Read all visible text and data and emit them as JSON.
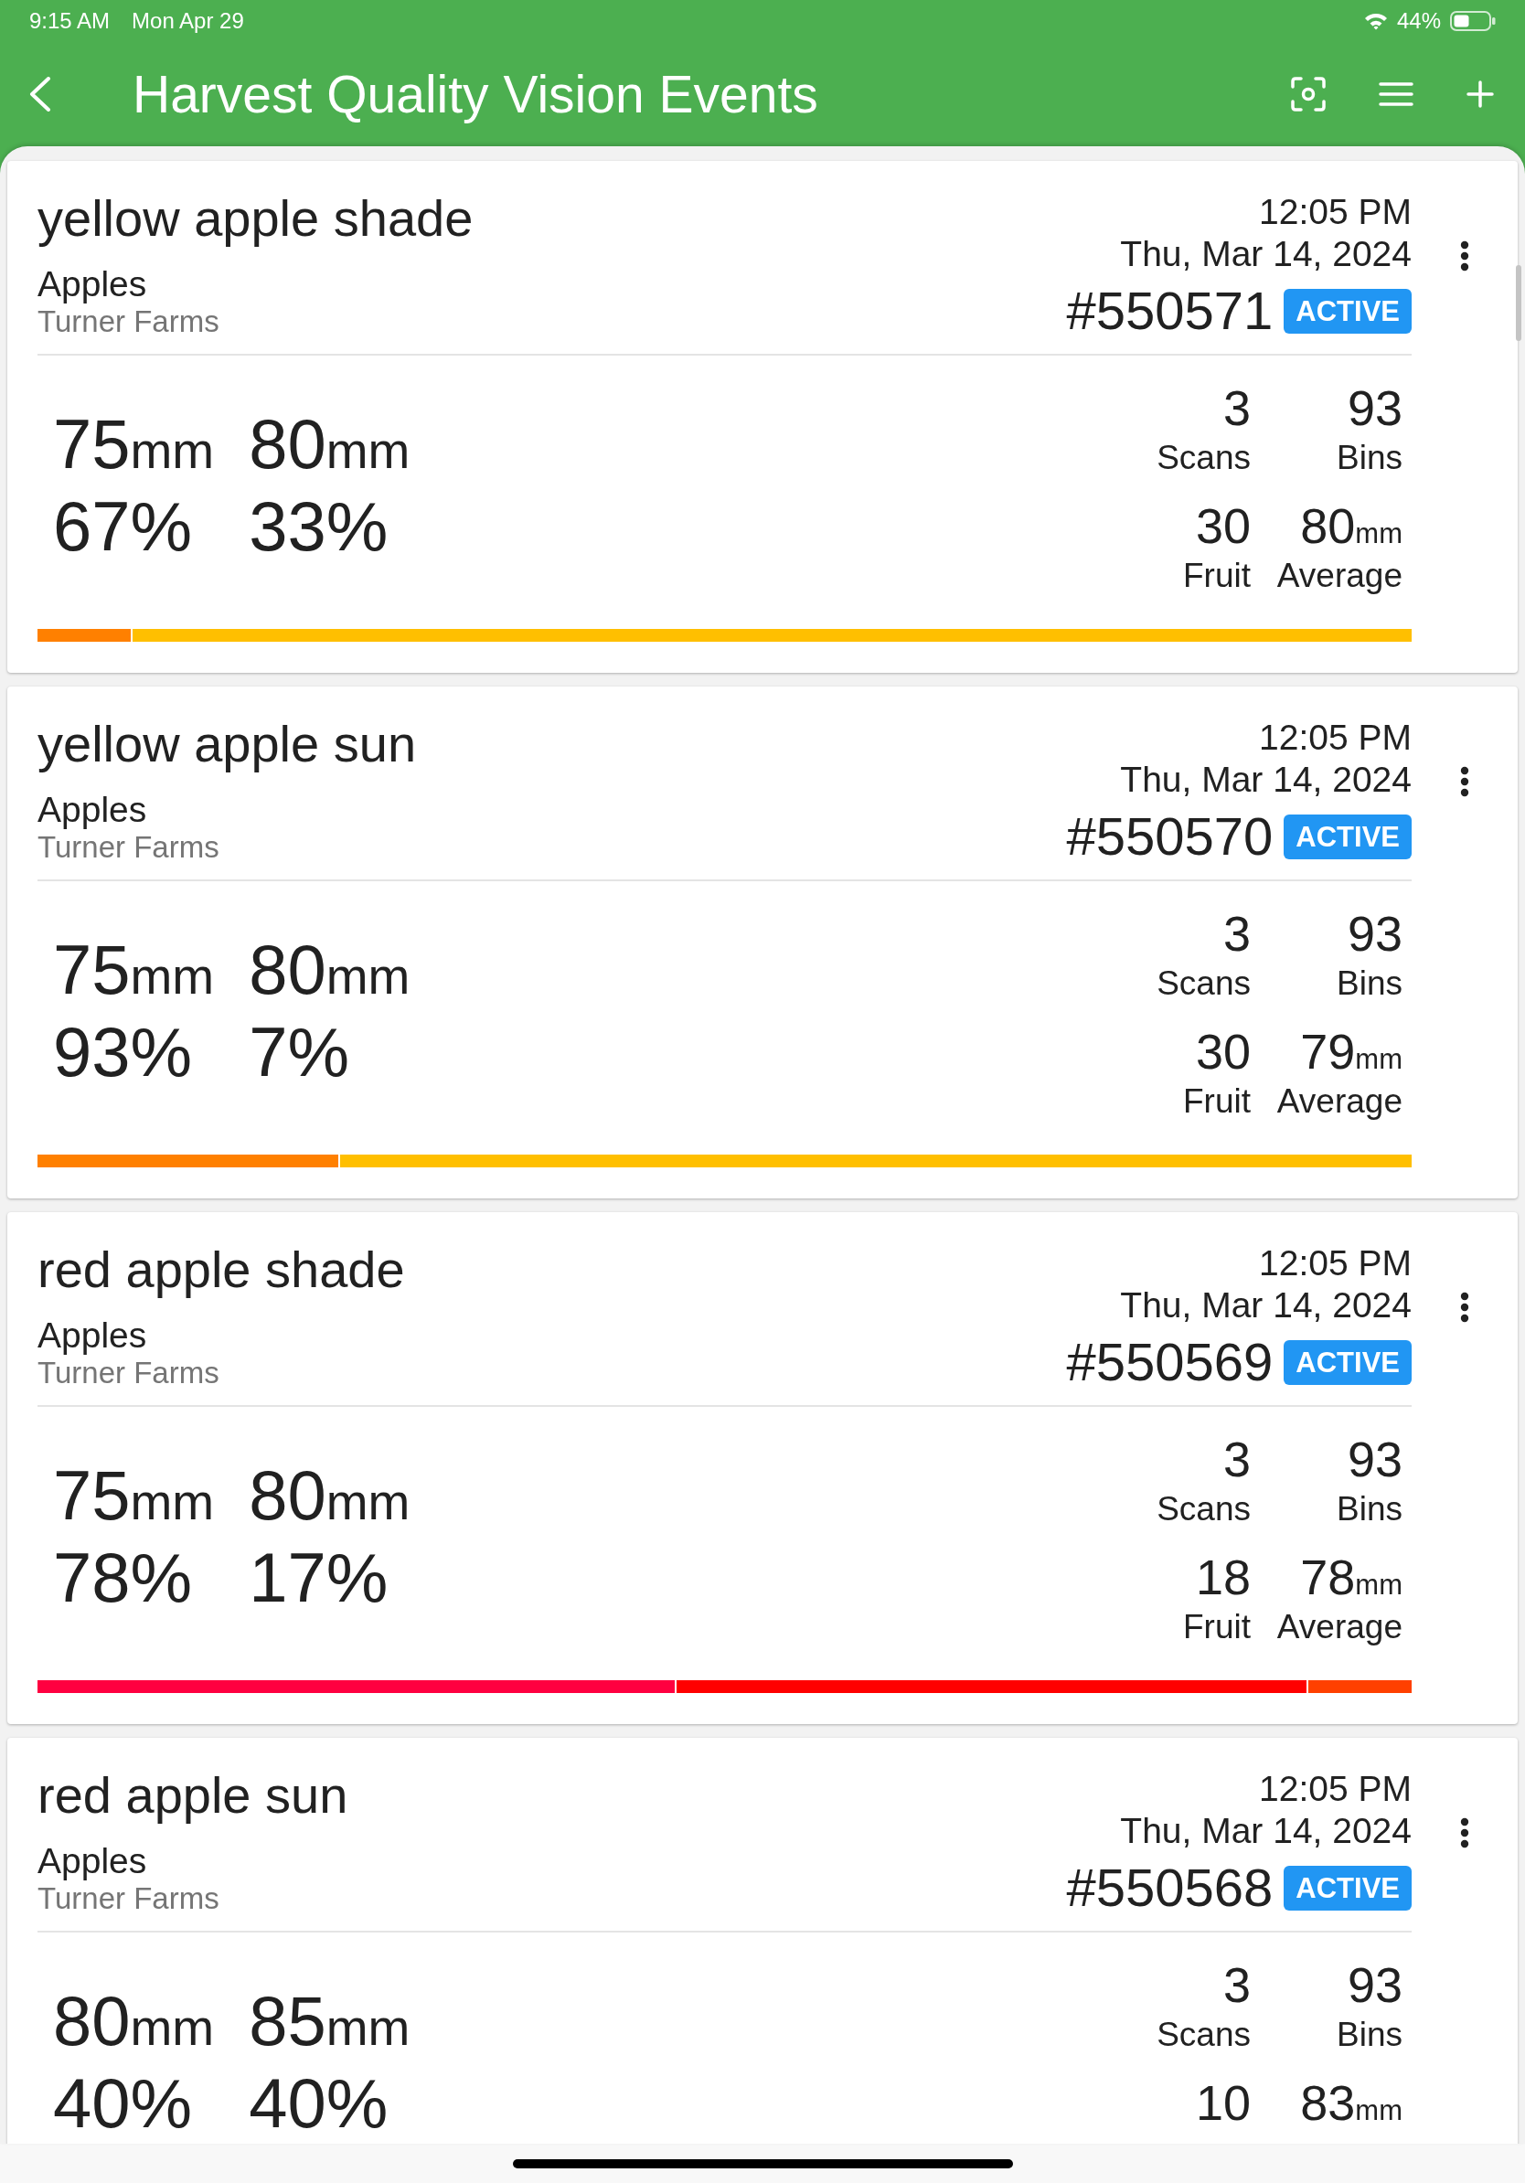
{
  "status_bar": {
    "time": "9:15 AM",
    "date": "Mon Apr 29",
    "battery": "44%"
  },
  "header": {
    "title": "Harvest Quality Vision Events"
  },
  "events": [
    {
      "name": "yellow apple shade",
      "commodity": "Apples",
      "grower": "Turner Farms",
      "time": "12:05 PM",
      "date": "Thu, Mar 14, 2024",
      "number": "#550571",
      "status": "ACTIVE",
      "sizes": [
        {
          "value": "75",
          "unit": "mm",
          "share": "67%"
        },
        {
          "value": "80",
          "unit": "mm",
          "share": "33%"
        }
      ],
      "stats": [
        {
          "value": "3",
          "label": "Scans"
        },
        {
          "value": "93",
          "label": "Bins"
        },
        {
          "value": "30",
          "label": "Fruit"
        },
        {
          "value": "80",
          "unit": "mm",
          "label": "Average"
        }
      ],
      "bar": {
        "color": "#ffbf00",
        "fills": [
          {
            "color": "#ff8000",
            "level": 0.069
          }
        ]
      }
    },
    {
      "name": "yellow apple sun",
      "commodity": "Apples",
      "grower": "Turner Farms",
      "time": "12:05 PM",
      "date": "Thu, Mar 14, 2024",
      "number": "#550570",
      "status": "ACTIVE",
      "sizes": [
        {
          "value": "75",
          "unit": "mm",
          "share": "93%"
        },
        {
          "value": "80",
          "unit": "mm",
          "share": "7%"
        }
      ],
      "stats": [
        {
          "value": "3",
          "label": "Scans"
        },
        {
          "value": "93",
          "label": "Bins"
        },
        {
          "value": "30",
          "label": "Fruit"
        },
        {
          "value": "79",
          "unit": "mm",
          "label": "Average"
        }
      ],
      "bar": {
        "color": "#ffbf00",
        "fills": [
          {
            "color": "#ff8000",
            "level": 0.22
          }
        ]
      }
    },
    {
      "name": "red apple shade",
      "commodity": "Apples",
      "grower": "Turner Farms",
      "time": "12:05 PM",
      "date": "Thu, Mar 14, 2024",
      "number": "#550569",
      "status": "ACTIVE",
      "sizes": [
        {
          "value": "75",
          "unit": "mm",
          "share": "78%"
        },
        {
          "value": "80",
          "unit": "mm",
          "share": "17%"
        }
      ],
      "stats": [
        {
          "value": "3",
          "label": "Scans"
        },
        {
          "value": "93",
          "label": "Bins"
        },
        {
          "value": "18",
          "label": "Fruit"
        },
        {
          "value": "78",
          "unit": "mm",
          "label": "Average"
        }
      ],
      "bar": {
        "color": "#ff4000",
        "fills": [
          {
            "color": "#ff0000",
            "level": 0.925
          },
          {
            "color": "#ff0040",
            "level": 0.465
          }
        ]
      }
    },
    {
      "name": "red apple sun",
      "commodity": "Apples",
      "grower": "Turner Farms",
      "time": "12:05 PM",
      "date": "Thu, Mar 14, 2024",
      "number": "#550568",
      "status": "ACTIVE",
      "sizes": [
        {
          "value": "80",
          "unit": "mm",
          "share": "40%"
        },
        {
          "value": "85",
          "unit": "mm",
          "share": "40%"
        }
      ],
      "stats": [
        {
          "value": "3",
          "label": "Scans"
        },
        {
          "value": "93",
          "label": "Bins"
        },
        {
          "value": "10"
        },
        {
          "value": "83",
          "unit": "mm"
        }
      ]
    }
  ]
}
